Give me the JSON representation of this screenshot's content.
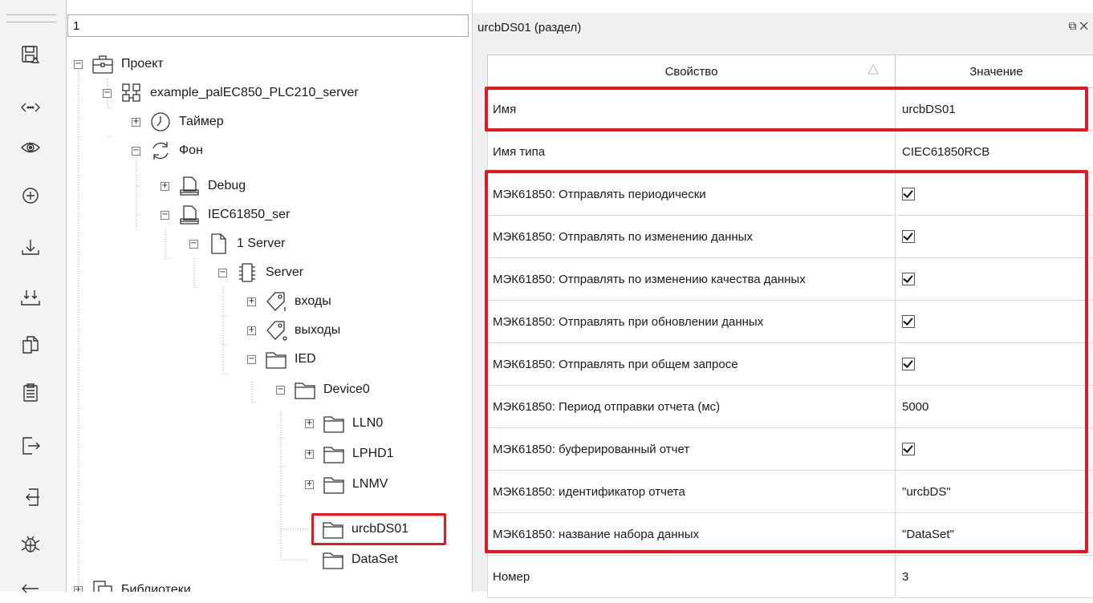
{
  "toolbar": {
    "buttons": [
      {
        "icon": "save-icon"
      },
      {
        "icon": "code-icon"
      },
      {
        "icon": "eye-icon"
      },
      {
        "icon": "add-icon"
      },
      {
        "icon": "download-icon"
      },
      {
        "icon": "download-multiple-icon"
      },
      {
        "icon": "copy-icon"
      },
      {
        "icon": "paste-icon"
      },
      {
        "icon": "export-icon"
      },
      {
        "icon": "import-icon"
      },
      {
        "icon": "debug-icon"
      },
      {
        "icon": "back-icon"
      }
    ]
  },
  "tree": {
    "search_value": "1",
    "nodes": [
      {
        "label": "Проект",
        "toggle": "−",
        "icon": "project-icon"
      },
      {
        "label": "example_palEC850_PLC210_server",
        "toggle": "−",
        "icon": "device-icon"
      },
      {
        "label": "Таймер",
        "toggle": "+",
        "icon": "timer-icon"
      },
      {
        "label": "Фон",
        "toggle": "−",
        "icon": "cycle-icon"
      },
      {
        "label": "Debug",
        "toggle": "+",
        "icon": "program-icon"
      },
      {
        "label": "IEC61850_ser",
        "toggle": "−",
        "icon": "program-icon"
      },
      {
        "label": "1 Server",
        "toggle": "−",
        "icon": "file-icon"
      },
      {
        "label": "Server",
        "toggle": "−",
        "icon": "chip-icon"
      },
      {
        "label": "входы",
        "toggle": "+",
        "icon": "tag-input-icon"
      },
      {
        "label": "выходы",
        "toggle": "+",
        "icon": "tag-output-icon"
      },
      {
        "label": "IED",
        "toggle": "−",
        "icon": "folder-icon"
      },
      {
        "label": "Device0",
        "toggle": "−",
        "icon": "folder-icon"
      },
      {
        "label": "LLN0",
        "toggle": "+",
        "icon": "folder-icon"
      },
      {
        "label": "LPHD1",
        "toggle": "+",
        "icon": "folder-icon"
      },
      {
        "label": "LNMV",
        "toggle": "+",
        "icon": "folder-icon"
      },
      {
        "label": "urcbDS01",
        "toggle": "",
        "icon": "folder-icon"
      },
      {
        "label": "DataSet",
        "toggle": "",
        "icon": "folder-icon"
      },
      {
        "label": "Библиотеки",
        "toggle": "+",
        "icon": "library-icon"
      }
    ]
  },
  "properties": {
    "title": "urcbDS01 (раздел)",
    "header_property": "Свойство",
    "header_value": "Значение",
    "rows": [
      {
        "name": "Имя",
        "value": "urcbDS01",
        "checked": false
      },
      {
        "name": "Имя типа",
        "value": "CIEC61850RCB",
        "checked": false
      },
      {
        "name": "МЭК61850: Отправлять периодически",
        "value": "",
        "checked": true
      },
      {
        "name": "МЭК61850: Отправлять по изменению данных",
        "value": "",
        "checked": true
      },
      {
        "name": "МЭК61850: Отправлять по изменению качества данных",
        "value": "",
        "checked": true
      },
      {
        "name": "МЭК61850: Отправлять при обновлении данных",
        "value": "",
        "checked": true
      },
      {
        "name": "МЭК61850: Отправлять при общем запросе",
        "value": "",
        "checked": true
      },
      {
        "name": "МЭК61850: Период отправки отчета (мс)",
        "value": "5000",
        "checked": false
      },
      {
        "name": "МЭК61850: буферированный отчет",
        "value": "",
        "checked": true
      },
      {
        "name": "МЭК61850: идентификатор отчета",
        "value": "\"urcbDS\"",
        "checked": false
      },
      {
        "name": "МЭК61850: название набора данных",
        "value": "\"DataSet\"",
        "checked": false
      },
      {
        "name": "Номер",
        "value": "3",
        "checked": false
      }
    ]
  },
  "colors": {
    "highlight": "#e8171d",
    "grid_border": "#d9d9d9",
    "panel_bg": "#f0f0f0"
  }
}
